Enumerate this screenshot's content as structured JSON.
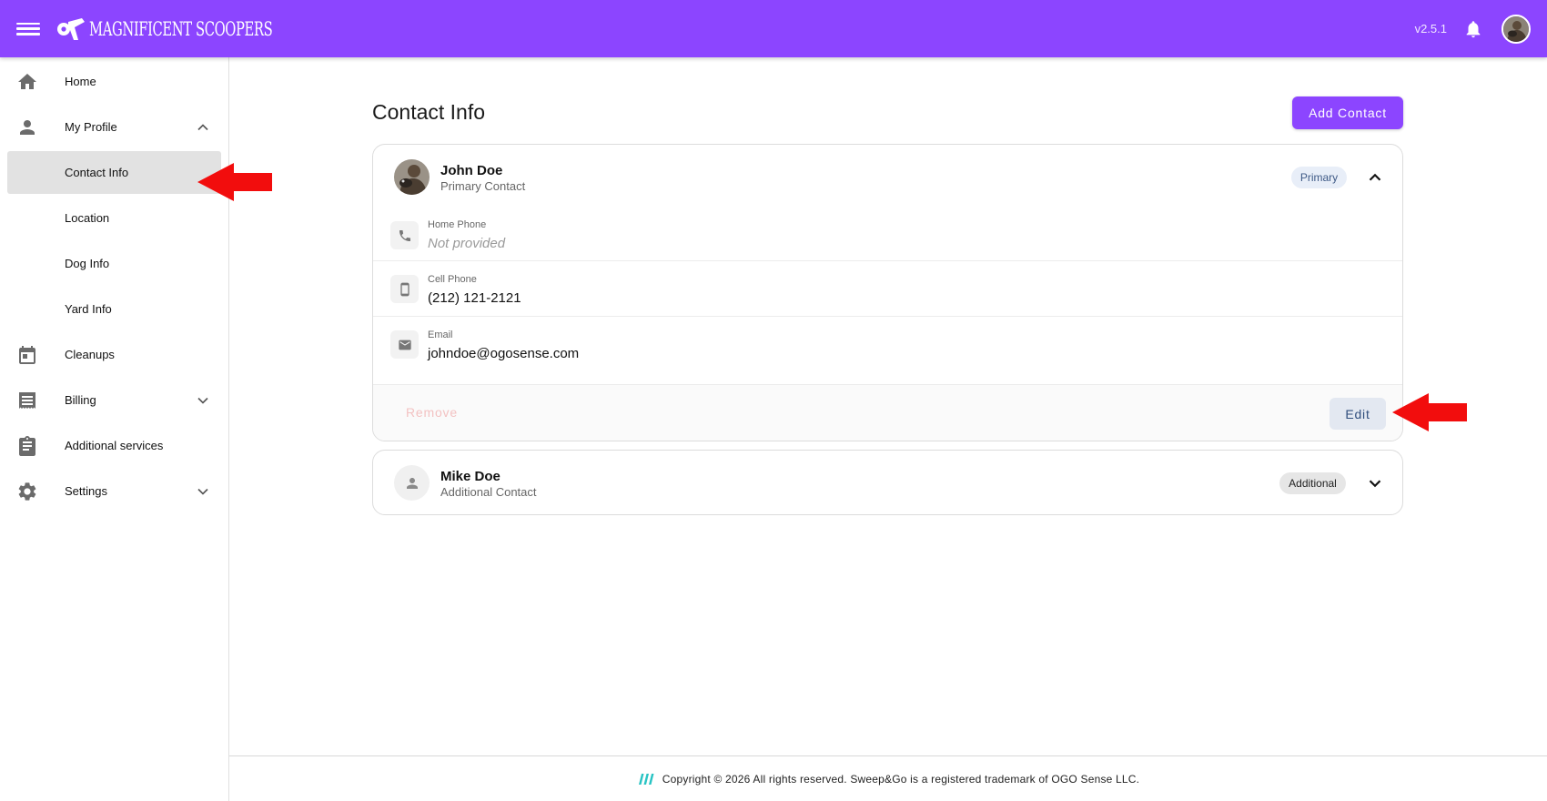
{
  "header": {
    "brand": "MAGNIFICENT SCOOPERS",
    "version": "v2.5.1",
    "accent_color": "#8c45ff"
  },
  "sidebar": {
    "items": [
      {
        "label": "Home",
        "icon": "home-icon"
      },
      {
        "label": "My Profile",
        "icon": "person-icon",
        "expanded": true
      },
      {
        "label": "Contact Info",
        "active": true
      },
      {
        "label": "Location"
      },
      {
        "label": "Dog Info"
      },
      {
        "label": "Yard Info"
      },
      {
        "label": "Cleanups",
        "icon": "calendar-icon"
      },
      {
        "label": "Billing",
        "icon": "receipt-icon",
        "expanded": false
      },
      {
        "label": "Additional services",
        "icon": "clipboard-icon"
      },
      {
        "label": "Settings",
        "icon": "gear-icon",
        "expanded": false
      }
    ]
  },
  "main": {
    "title": "Contact Info",
    "add_button": "Add Contact",
    "contacts": [
      {
        "name": "John Doe",
        "role": "Primary Contact",
        "badge": "Primary",
        "expanded": true,
        "fields": [
          {
            "label": "Home Phone",
            "value": "Not provided",
            "icon": "phone-icon"
          },
          {
            "label": "Cell Phone",
            "value": "(212) 121-2121",
            "icon": "smartphone-icon"
          },
          {
            "label": "Email",
            "value": "johndoe@ogosense.com",
            "icon": "email-icon"
          }
        ],
        "remove_label": "Remove",
        "edit_label": "Edit"
      },
      {
        "name": "Mike Doe",
        "role": "Additional Contact",
        "badge": "Additional",
        "expanded": false
      }
    ]
  },
  "footer": {
    "text": "Copyright © 2026 All rights reserved. Sweep&Go is a registered trademark of OGO Sense LLC."
  }
}
